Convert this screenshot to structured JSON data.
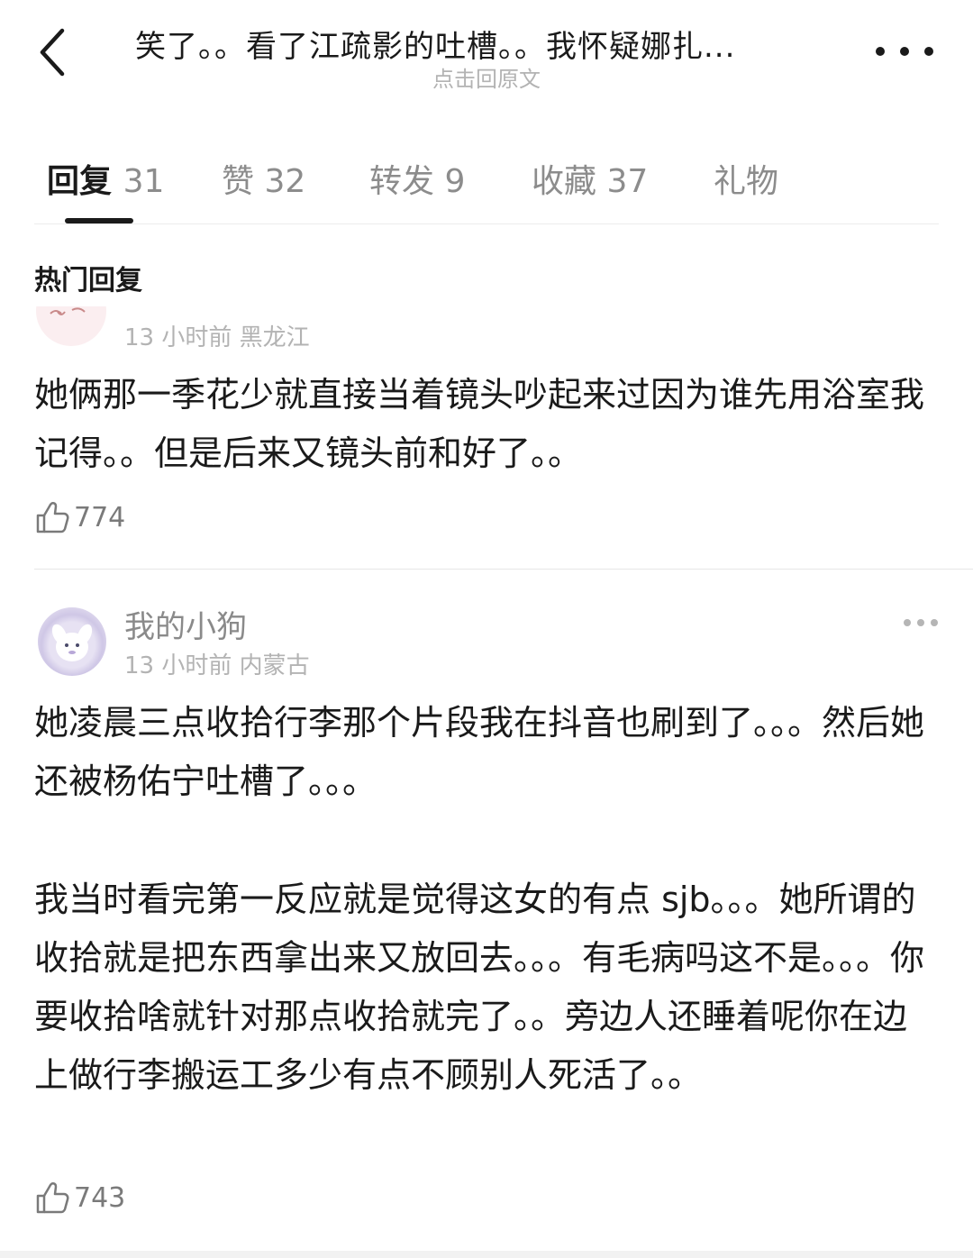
{
  "header": {
    "back_icon": "chevron-left-icon",
    "title": "笑了。。看了江疏影的吐槽。。我怀疑娜扎...",
    "subtitle": "点击回原文",
    "more_icon": "more-horizontal-icon"
  },
  "tabs": [
    {
      "label": "回复",
      "count": "31",
      "active": true
    },
    {
      "label": "赞",
      "count": "32",
      "active": false
    },
    {
      "label": "转发",
      "count": "9",
      "active": false
    },
    {
      "label": "收藏",
      "count": "37",
      "active": false
    },
    {
      "label": "礼物",
      "count": "",
      "active": false
    }
  ],
  "section_title": "热门回复",
  "comments": [
    {
      "time": "13 小时前",
      "location": "黑龙江",
      "text": "她俩那一季花少就直接当着镜头吵起来过因为谁先用浴室我记得。。但是后来又镜头前和好了。。",
      "likes": "774"
    },
    {
      "username": "我的小狗",
      "time": "13 小时前",
      "location": "内蒙古",
      "text_p1": "她凌晨三点收拾行李那个片段我在抖音也刷到了。。。然后她还被杨佑宁吐槽了。。。",
      "text_p2": "我当时看完第一反应就是觉得这女的有点 sjb。。。她所谓的收拾就是把东西拿出来又放回去。。。有毛病吗这不是。。。你要收拾啥就针对那点收拾就完了。。旁边人还睡着呢你在边上做行李搬运工多少有点不顾别人死活了。。",
      "likes": "743"
    }
  ],
  "colors": {
    "text_primary": "#1a1a1a",
    "text_secondary": "#8c8c8c",
    "text_muted": "#b3b3b3",
    "divider": "#e6e6e6"
  }
}
